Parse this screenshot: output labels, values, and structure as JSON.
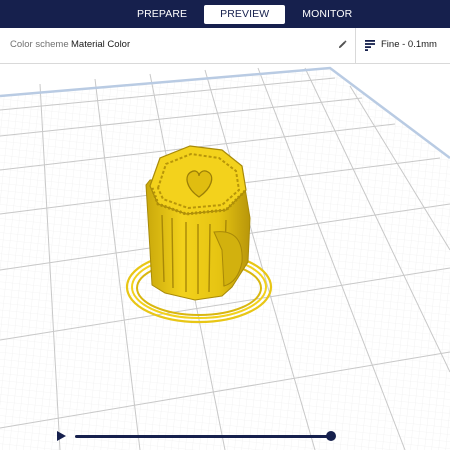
{
  "stage_tabs": [
    {
      "label": "PREPARE",
      "active": false
    },
    {
      "label": "PREVIEW",
      "active": true
    },
    {
      "label": "MONITOR",
      "active": false
    }
  ],
  "view_settings": {
    "color_scheme_label": "Color scheme",
    "color_scheme_value": "Material Color"
  },
  "print_settings": {
    "quality": "Fine - 0.1mm"
  },
  "icons": {
    "edit": "pencil-icon",
    "print_settings": "print-settings-icon",
    "play": "play-icon"
  },
  "colors": {
    "stage_bar": "#16204d",
    "material": "#f2cf17",
    "build_plate_grid": "#c8c8c8",
    "build_plate_border": "#b9cbe3"
  },
  "playback": {
    "layer_progress": 1.0
  }
}
